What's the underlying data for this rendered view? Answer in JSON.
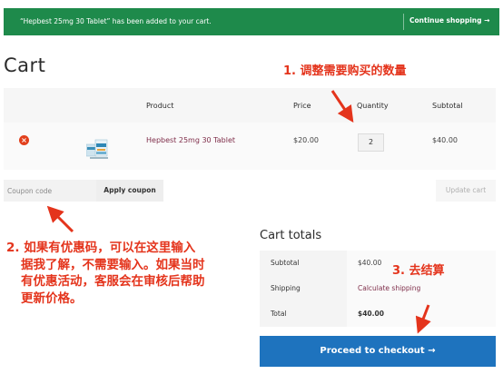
{
  "notice": {
    "message": "“Hepbest 25mg 30 Tablet” has been added to your cart.",
    "continue_label": "Continue shopping →"
  },
  "page": {
    "title": "Cart"
  },
  "table": {
    "headers": {
      "product": "Product",
      "price": "Price",
      "quantity": "Quantity",
      "subtotal": "Subtotal"
    },
    "rows": [
      {
        "remove_icon": "×",
        "product": "Hepbest 25mg 30 Tablet",
        "price": "$20.00",
        "quantity": "2",
        "subtotal": "$40.00"
      }
    ]
  },
  "coupon": {
    "placeholder": "Coupon code",
    "apply_label": "Apply coupon",
    "update_label": "Update cart"
  },
  "totals": {
    "title": "Cart totals",
    "subtotal_label": "Subtotal",
    "subtotal_value": "$40.00",
    "shipping_label": "Shipping",
    "shipping_value": "Calculate shipping",
    "total_label": "Total",
    "total_value": "$40.00",
    "checkout_label": "Proceed to checkout →"
  },
  "annotations": {
    "step1": "1. 调整需要购买的数量",
    "step2_lines": [
      "2. 如果有优惠码，可以在这里输入",
      "据我了解，不需要输入。如果当时",
      "有优惠活动，客服会在审核后帮助",
      "更新价格。"
    ],
    "step3": "3. 去结算"
  },
  "colors": {
    "notice_bg": "#1e8a4b",
    "checkout_bg": "#1e73be",
    "annotation": "#e4341c",
    "link": "#7f2e4a"
  }
}
